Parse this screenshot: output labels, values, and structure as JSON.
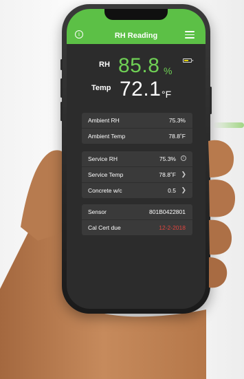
{
  "header": {
    "title": "RH Reading"
  },
  "icons": {
    "info": "info-icon",
    "menu": "hamburger-menu-icon",
    "battery": "battery-icon",
    "chevron": "chevron-right-icon"
  },
  "reading": {
    "rh_label": "RH",
    "rh_value": "85.8",
    "rh_unit": "%",
    "temp_label": "Temp",
    "temp_value": "72.1",
    "temp_unit": "°F"
  },
  "ambient": [
    {
      "label": "Ambient RH",
      "value": "75.3%"
    },
    {
      "label": "Ambient Temp",
      "value": "78.8˚F"
    }
  ],
  "service": [
    {
      "label": "Service RH",
      "value": "75.3%"
    },
    {
      "label": "Service Temp",
      "value": "78.8˚F"
    },
    {
      "label": "Concrete w/c",
      "value": "0.5"
    }
  ],
  "sensor": [
    {
      "label": "Sensor",
      "value": "801B0422801"
    },
    {
      "label": "Cal Cert due",
      "value": "12-2-2018"
    }
  ],
  "colors": {
    "accent": "#5cc046",
    "reading_green": "#6fd055",
    "warning_red": "#e0463f",
    "battery": "#e5d500"
  }
}
